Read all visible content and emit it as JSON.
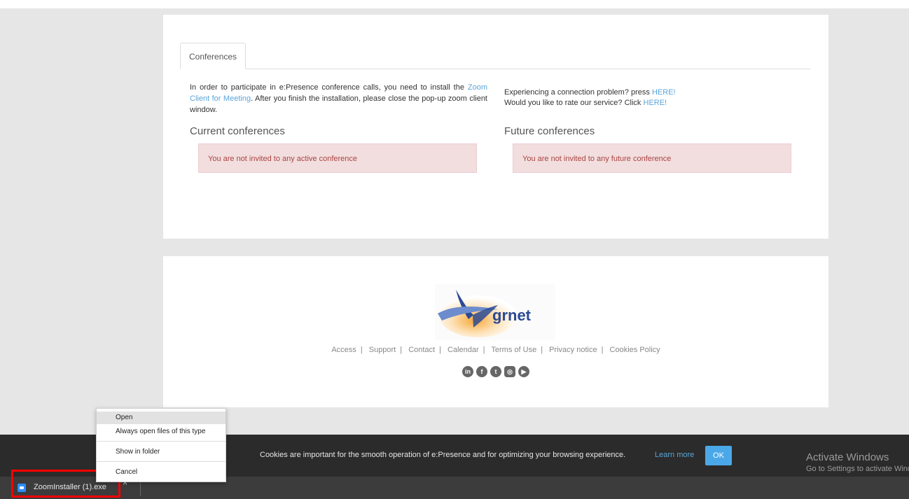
{
  "tabs": {
    "conferences": "Conferences"
  },
  "intro": {
    "text_before": "In order to participate in e:Presence conference calls, you need to install the ",
    "link": "Zoom Client for Meeting",
    "text_after": ". After you finish the installation, please close the pop-up zoom client window."
  },
  "help": {
    "line1_text": "Experiencing a connection problem? press ",
    "line1_link": "HERE!",
    "line2_text": "Would you like to rate our service? Click ",
    "line2_link": "HERE!"
  },
  "current": {
    "title": "Current conferences",
    "alert": "You are not invited to any active conference"
  },
  "future": {
    "title": "Future conferences",
    "alert": "You are not invited to any future conference"
  },
  "footer": {
    "logo_text": "grnet",
    "links": [
      "Access",
      "Support",
      "Contact",
      "Calendar",
      "Terms of Use",
      "Privacy notice",
      "Cookies Policy"
    ],
    "social_icons": [
      "linkedin-icon",
      "facebook-icon",
      "twitter-icon",
      "instagram-icon",
      "youtube-icon"
    ]
  },
  "cookie": {
    "text": "Cookies are important for the smooth operation of e:Presence and for optimizing your browsing experience.",
    "learn_more": "Learn more",
    "ok": "OK"
  },
  "watermark": {
    "line1": "Activate Windows",
    "line2": "Go to Settings to activate Windows."
  },
  "context_menu": {
    "items": [
      "Open",
      "Always open files of this type",
      "Show in folder",
      "Cancel"
    ]
  },
  "download": {
    "filename": "ZoomInstaller (1).exe",
    "chevron": "^"
  },
  "colors": {
    "link": "#5aa5d8",
    "alert_bg": "#f2dede",
    "alert_text": "#a94442",
    "ok_button": "#4aa8e8",
    "highlight": "#ff0000"
  }
}
